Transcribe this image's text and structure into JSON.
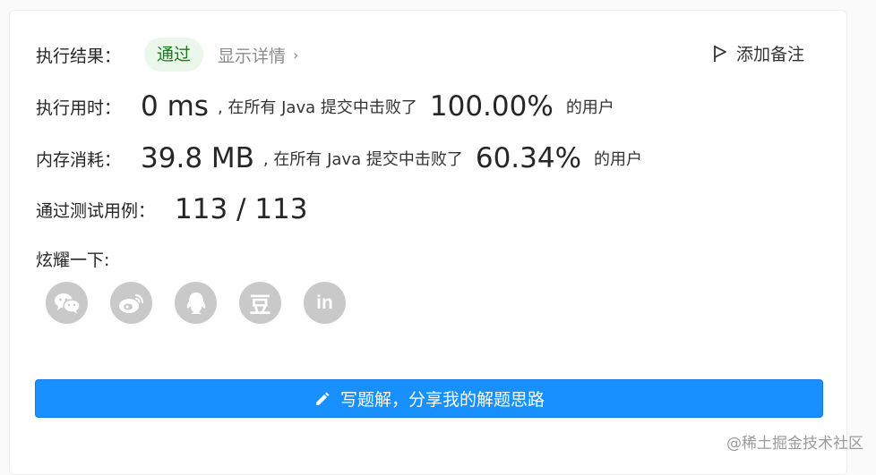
{
  "result": {
    "label": "执行结果：",
    "status_badge": "通过",
    "details_link": "显示详情",
    "add_note": "添加备注"
  },
  "runtime": {
    "label": "执行用时：",
    "value": "0 ms",
    "mid_text": ", 在所有 Java 提交中击败了",
    "percent": "100.00%",
    "suffix": "的用户"
  },
  "memory": {
    "label": "内存消耗：",
    "value": "39.8 MB",
    "mid_text": ", 在所有 Java 提交中击败了",
    "percent": "60.34%",
    "suffix": "的用户"
  },
  "tests": {
    "label": "通过测试用例：",
    "value": "113 / 113"
  },
  "share": {
    "label": "炫耀一下:",
    "icons": [
      {
        "name": "wechat-icon"
      },
      {
        "name": "weibo-icon"
      },
      {
        "name": "qq-icon"
      },
      {
        "name": "douban-icon",
        "glyph": "豆"
      },
      {
        "name": "linkedin-icon",
        "glyph": "in"
      }
    ]
  },
  "solution_button": "写题解，分享我的解题思路",
  "watermark": "@稀土掘金技术社区",
  "colors": {
    "accent": "#1890ff",
    "success_bg": "#eaf7ea",
    "success_text": "#1b7a1b",
    "icon_gray": "#c9c9c9"
  }
}
